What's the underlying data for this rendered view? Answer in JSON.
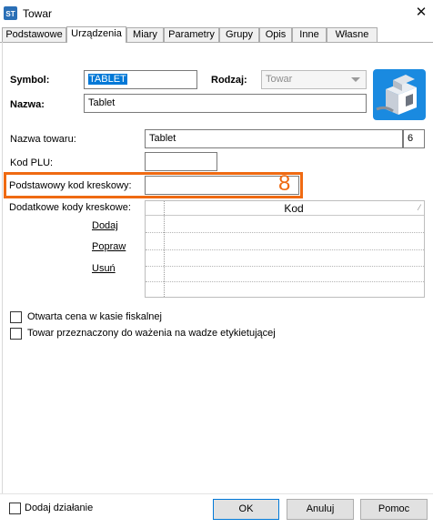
{
  "window": {
    "title": "Towar",
    "app_icon_text": "ST"
  },
  "tabs": [
    {
      "label": "Podstawowe"
    },
    {
      "label": "Urządzenia"
    },
    {
      "label": "Miary"
    },
    {
      "label": "Parametry"
    },
    {
      "label": "Grupy"
    },
    {
      "label": "Opis"
    },
    {
      "label": "Inne"
    },
    {
      "label": "Własne"
    }
  ],
  "form": {
    "symbol_label": "Symbol:",
    "symbol_value": "TABLET",
    "rodzaj_label": "Rodzaj:",
    "rodzaj_value": "Towar",
    "nazwa_label": "Nazwa:",
    "nazwa_value": "Tablet",
    "nazwa_towaru_label": "Nazwa towaru:",
    "nazwa_towaru_value": "Tablet",
    "nazwa_towaru_count": "6",
    "kod_plu_label": "Kod PLU:",
    "kod_plu_value": "",
    "podstawowy_kod_label": "Podstawowy kod kreskowy:",
    "podstawowy_kod_value": "",
    "dodatkowe_kody_label": "Dodatkowe kody kreskowe:",
    "annotation_marker": "8"
  },
  "barcode_grid": {
    "column_header": "Kod",
    "rows": []
  },
  "grid_actions": {
    "add": "Dodaj",
    "edit": "Popraw",
    "delete": "Usuń"
  },
  "checkboxes": {
    "open_price": "Otwarta cena w kasie fiskalnej",
    "weighing": "Towar przeznaczony do ważenia na wadze etykietującej",
    "add_action": "Dodaj działanie"
  },
  "buttons": {
    "ok": "OK",
    "cancel": "Anuluj",
    "help": "Pomoc"
  },
  "colors": {
    "highlight": "#ef6a12",
    "selection": "#0078d7",
    "logo": "#1a8ae0"
  }
}
